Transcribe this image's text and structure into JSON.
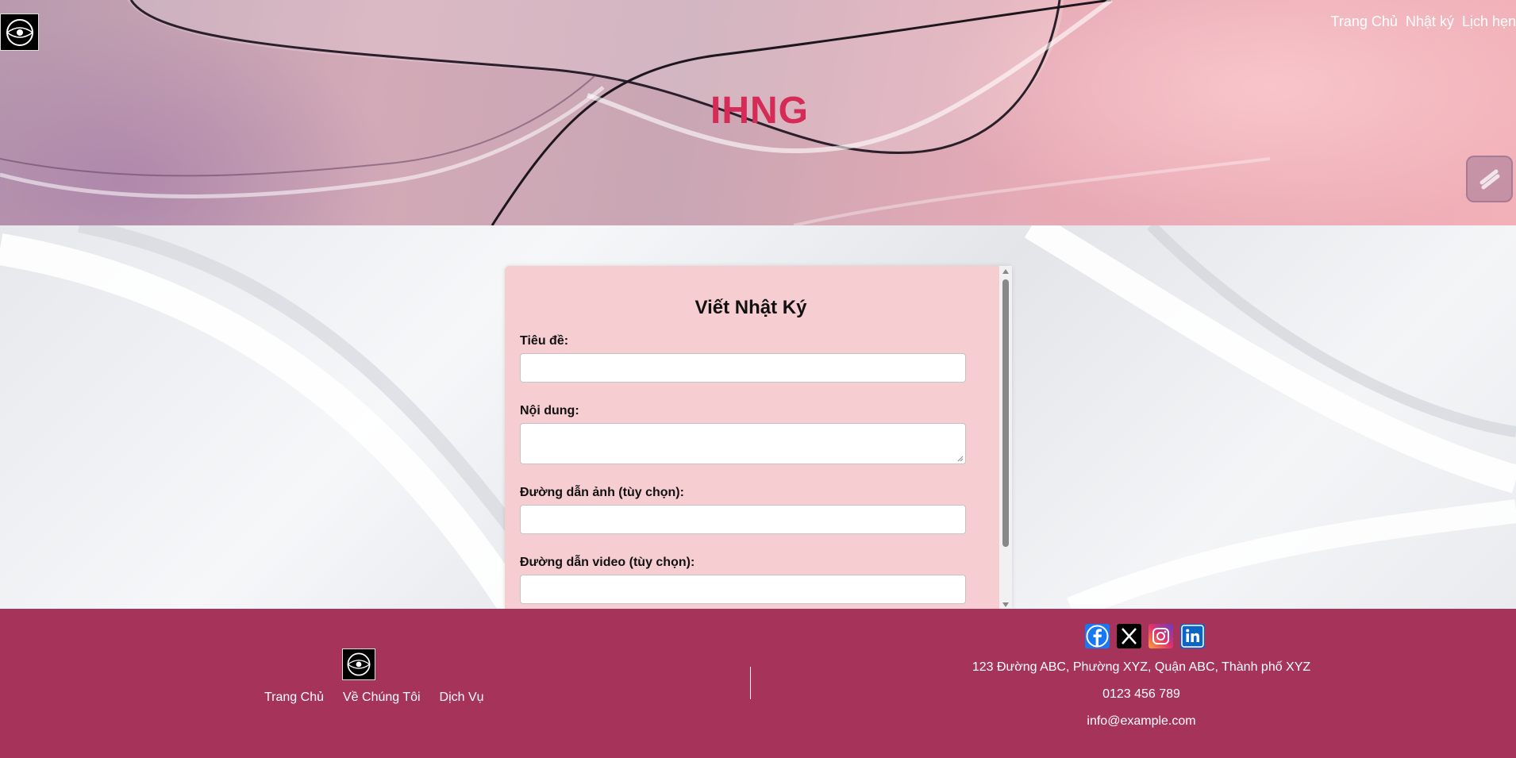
{
  "header": {
    "brand": "IHNG",
    "nav": [
      "Trang Chủ",
      "Nhật ký",
      "Lịch hẹn"
    ]
  },
  "form": {
    "title": "Viết Nhật Ký",
    "fields": [
      {
        "label": "Tiêu đề:",
        "value": ""
      },
      {
        "label": "Nội dung:",
        "value": ""
      },
      {
        "label": "Đường dẫn ảnh (tùy chọn):",
        "value": ""
      },
      {
        "label": "Đường dẫn video (tùy chọn):",
        "value": ""
      }
    ]
  },
  "footer": {
    "links": [
      "Trang Chủ",
      "Về Chúng Tôi",
      "Dịch Vụ"
    ],
    "socials": [
      "facebook-icon",
      "x-icon",
      "instagram-icon",
      "linkedin-icon"
    ],
    "address": "123 Đường ABC, Phường XYZ, Quận ABC, Thành phố XYZ",
    "phone": "0123 456 789",
    "email": "info@example.com"
  },
  "colors": {
    "brand": "#d42b57",
    "footer_bg": "#a6345a",
    "card_bg": "#f6cdd0"
  }
}
